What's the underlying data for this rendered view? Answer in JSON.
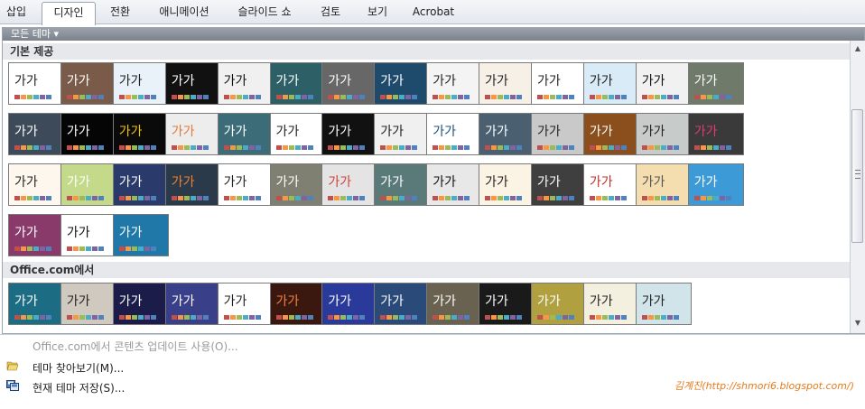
{
  "ribbon": {
    "tabs": [
      {
        "label": "삽입",
        "active": false
      },
      {
        "label": "디자인",
        "active": true
      },
      {
        "label": "전환",
        "active": false
      },
      {
        "label": "애니메이션",
        "active": false
      },
      {
        "label": "슬라이드 쇼",
        "active": false
      },
      {
        "label": "검토",
        "active": false
      },
      {
        "label": "보기",
        "active": false
      },
      {
        "label": "Acrobat",
        "active": false
      }
    ]
  },
  "gallery": {
    "filter_label": "모든 테마 ▾",
    "sections": [
      {
        "title": "기본 제공",
        "themes": [
          {
            "bg": "#ffffff",
            "fg": "#222222"
          },
          {
            "bg": "#7a5a48",
            "fg": "#ffffff"
          },
          {
            "bg": "#e9f2f8",
            "fg": "#222222"
          },
          {
            "bg": "#111111",
            "fg": "#ffffff"
          },
          {
            "bg": "#f0f0f0",
            "fg": "#111111"
          },
          {
            "bg": "#2c5f66",
            "fg": "#ffffff"
          },
          {
            "bg": "#676767",
            "fg": "#ffffff"
          },
          {
            "bg": "#1e4a6c",
            "fg": "#ffffff"
          },
          {
            "bg": "#f4f4f4",
            "fg": "#222222"
          },
          {
            "bg": "#f6f0e6",
            "fg": "#222222"
          },
          {
            "bg": "#ffffff",
            "fg": "#222222"
          },
          {
            "bg": "#d8ebf6",
            "fg": "#222222"
          },
          {
            "bg": "#f1f1f1",
            "fg": "#111111"
          },
          {
            "bg": "#6f7a6a",
            "fg": "#ffffff"
          },
          {
            "bg": "#3c4a5a",
            "fg": "#ffffff"
          },
          {
            "bg": "#050505",
            "fg": "#ffffff"
          },
          {
            "bg": "#0a0a0a",
            "fg": "#f5c400"
          },
          {
            "bg": "#ededed",
            "fg": "#e07b39"
          },
          {
            "bg": "#3c6c78",
            "fg": "#ffffff"
          },
          {
            "bg": "#ffffff",
            "fg": "#222222"
          },
          {
            "bg": "#111111",
            "fg": "#ffffff"
          },
          {
            "bg": "#f0f0f0",
            "fg": "#222222"
          },
          {
            "bg": "#ffffff",
            "fg": "#1f4e79"
          },
          {
            "bg": "#4a6070",
            "fg": "#ffffff"
          },
          {
            "bg": "#c9c9c9",
            "fg": "#222222"
          },
          {
            "bg": "#8a4f1c",
            "fg": "#ffffff"
          },
          {
            "bg": "#c7ccca",
            "fg": "#222222"
          },
          {
            "bg": "#3a3a3a",
            "fg": "#e03a7a"
          },
          {
            "bg": "#fdf7ee",
            "fg": "#222222"
          },
          {
            "bg": "#c4d98a",
            "fg": "#ffffff"
          },
          {
            "bg": "#2a3a6a",
            "fg": "#ffffff"
          },
          {
            "bg": "#2a3a4a",
            "fg": "#f08030"
          },
          {
            "bg": "#ffffff",
            "fg": "#222222"
          },
          {
            "bg": "#7f7f72",
            "fg": "#ffffff"
          },
          {
            "bg": "#e4e4e4",
            "fg": "#d0403a"
          },
          {
            "bg": "#5a7a7a",
            "fg": "#ffffff"
          },
          {
            "bg": "#e8e8e8",
            "fg": "#111111"
          },
          {
            "bg": "#fbf3e4",
            "fg": "#222222"
          },
          {
            "bg": "#3f3f3f",
            "fg": "#ffffff"
          },
          {
            "bg": "#ffffff",
            "fg": "#c0302a"
          },
          {
            "bg": "#f4deb0",
            "fg": "#555555"
          },
          {
            "bg": "#3c9ad6",
            "fg": "#ffffff"
          },
          {
            "bg": "#8a3a6a",
            "fg": "#ffffff"
          },
          {
            "bg": "#ffffff",
            "fg": "#111111"
          },
          {
            "bg": "#1f78a8",
            "fg": "#ffffff"
          }
        ]
      },
      {
        "title": "Office.com에서",
        "themes": [
          {
            "bg": "#1c6d84",
            "fg": "#ffffff"
          },
          {
            "bg": "#cfc9c0",
            "fg": "#222222"
          },
          {
            "bg": "#1c1c4a",
            "fg": "#ffffff"
          },
          {
            "bg": "#3a3f8a",
            "fg": "#ffffff"
          },
          {
            "bg": "#ffffff",
            "fg": "#222222"
          },
          {
            "bg": "#3a1810",
            "fg": "#f08040"
          },
          {
            "bg": "#2a3a9a",
            "fg": "#ffffff"
          },
          {
            "bg": "#2a4a7a",
            "fg": "#ffffff"
          },
          {
            "bg": "#6a6250",
            "fg": "#ffffff"
          },
          {
            "bg": "#1a1a1a",
            "fg": "#ffffff"
          },
          {
            "bg": "#b0a040",
            "fg": "#ffffff"
          },
          {
            "bg": "#f4f0e0",
            "fg": "#222222"
          },
          {
            "bg": "#d0e4ea",
            "fg": "#222222"
          }
        ]
      }
    ],
    "sample_text": "가가",
    "swatches": [
      "#c0504d",
      "#f79646",
      "#9bbb59",
      "#4bacc6",
      "#8064a2",
      "#4f81bd"
    ]
  },
  "menu": {
    "items": [
      {
        "label": "Office.com에서 콘텐츠 업데이트 사용(O)...",
        "enabled": false,
        "icon": ""
      },
      {
        "label": "테마 찾아보기(M)...",
        "enabled": true,
        "icon": "folder-open-icon"
      },
      {
        "label": "현재 테마 저장(S)...",
        "enabled": true,
        "icon": "save-theme-icon"
      }
    ],
    "credit": "김계진(http://shmori6.blogspot.com/)"
  },
  "colors": {
    "credit": "#e87a1a",
    "panel_header": "#8a9099",
    "accent": "#4f81bd"
  }
}
